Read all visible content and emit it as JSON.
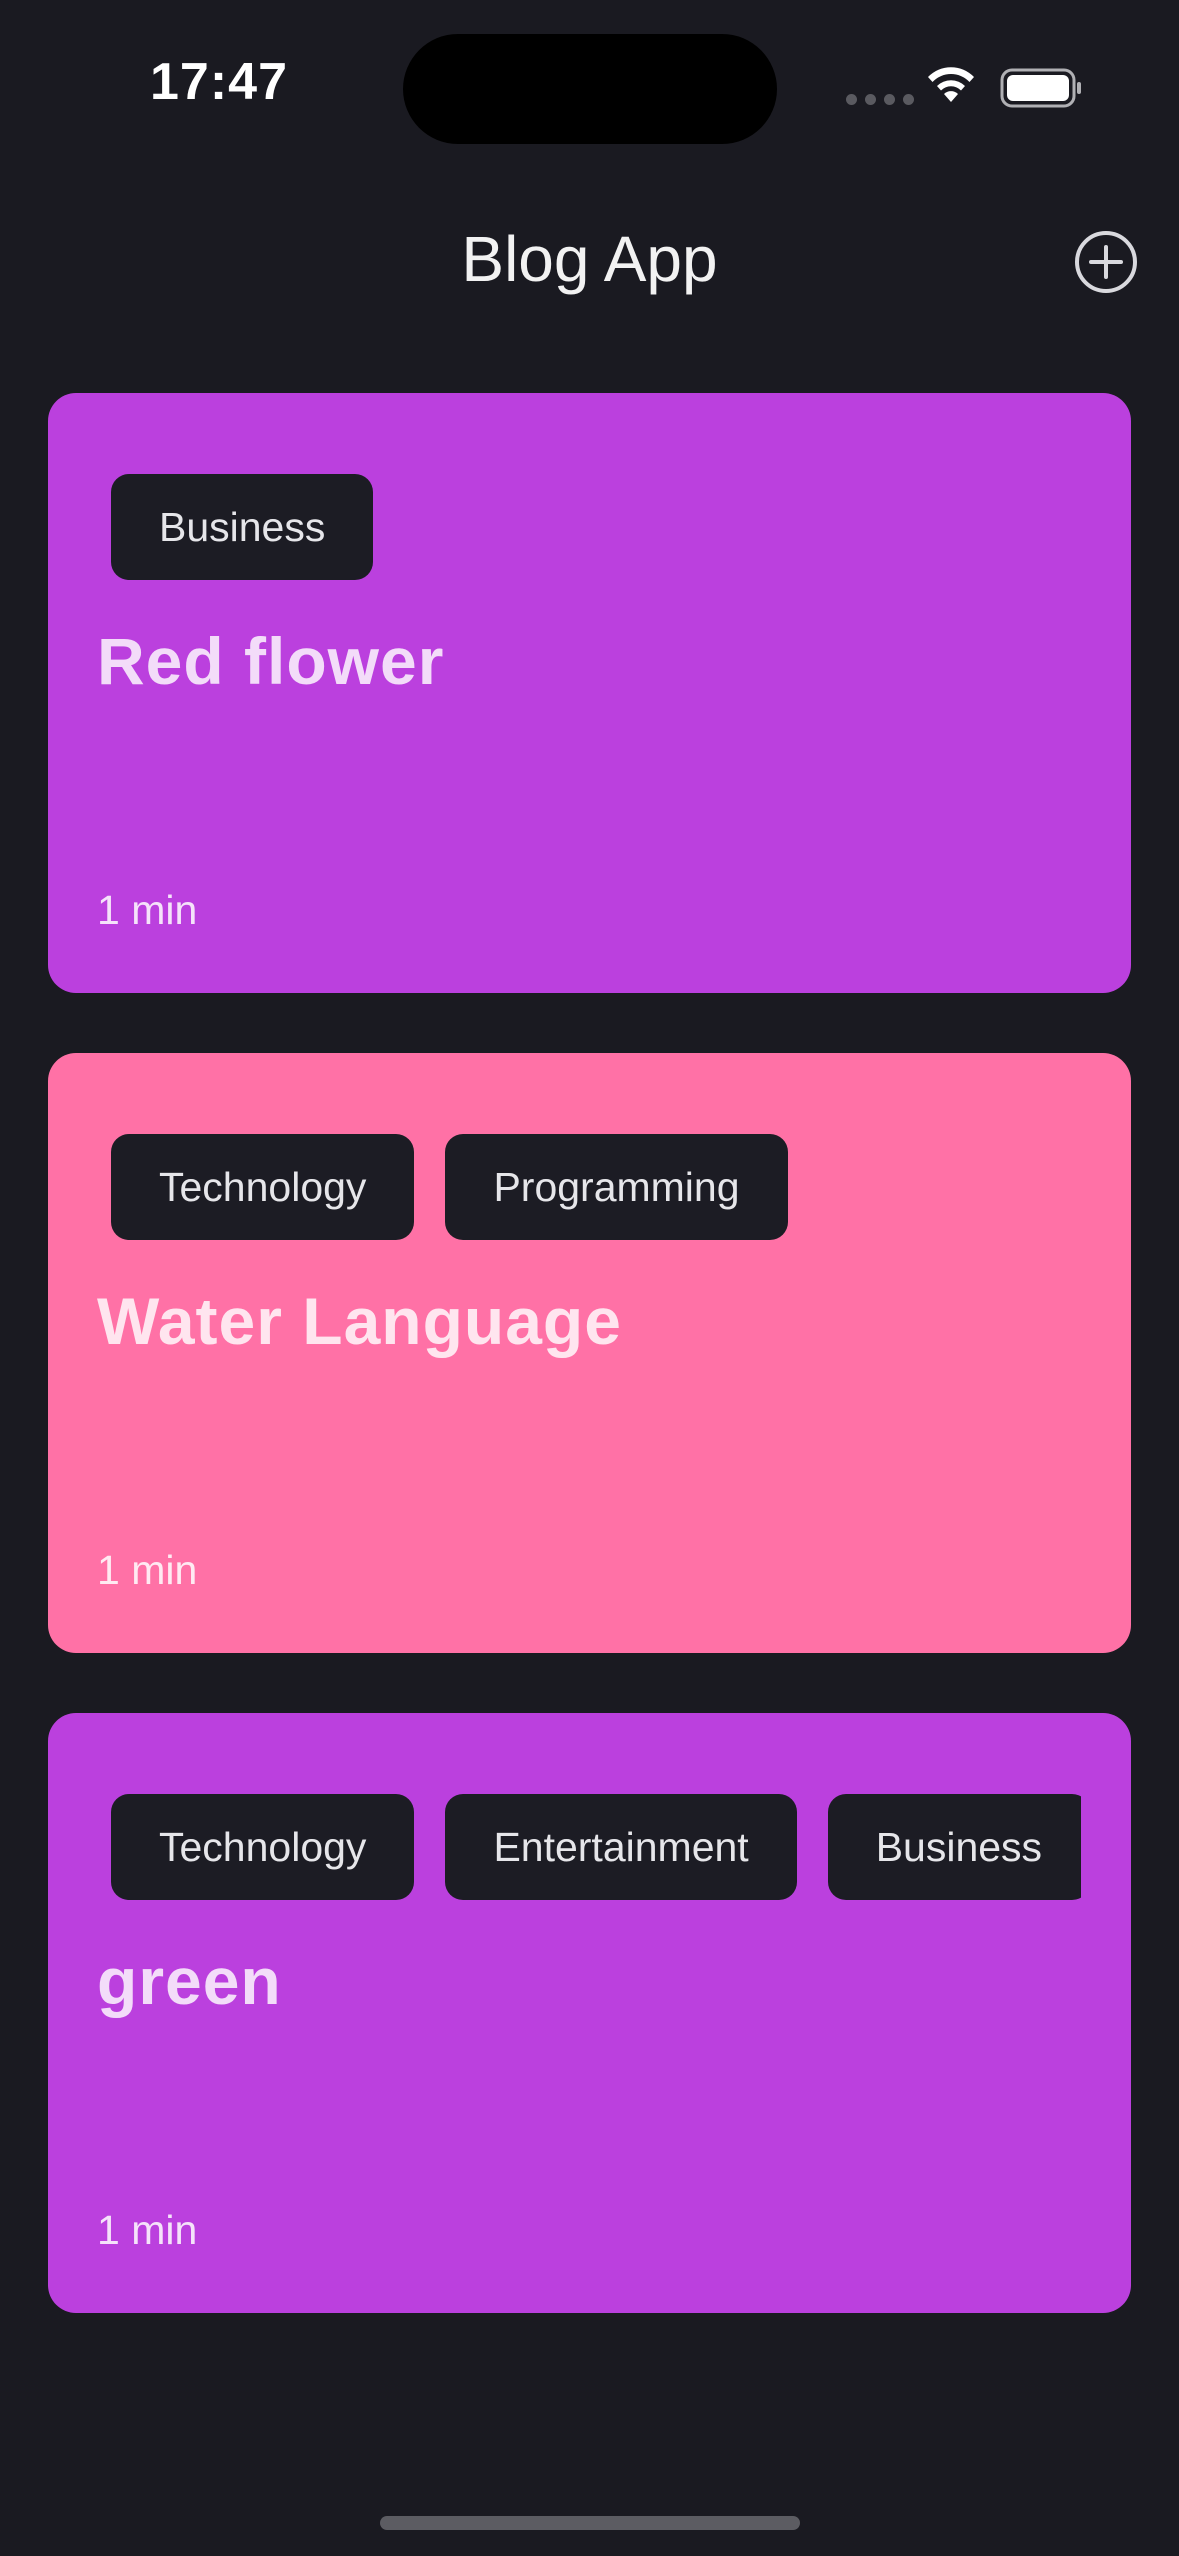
{
  "status_bar": {
    "time": "17:47"
  },
  "nav": {
    "title": "Blog App",
    "add_icon": "plus-circle-icon"
  },
  "posts": [
    {
      "title": "Red flower",
      "tags": [
        "Business"
      ],
      "read_time": "1 min",
      "color": "#bb40de"
    },
    {
      "title": "Water Language",
      "tags": [
        "Technology",
        "Programming"
      ],
      "read_time": "1 min",
      "color": "#ff71a6"
    },
    {
      "title": "green",
      "tags": [
        "Technology",
        "Entertainment",
        "Business"
      ],
      "read_time": "1 min",
      "color": "#bb40de"
    }
  ]
}
